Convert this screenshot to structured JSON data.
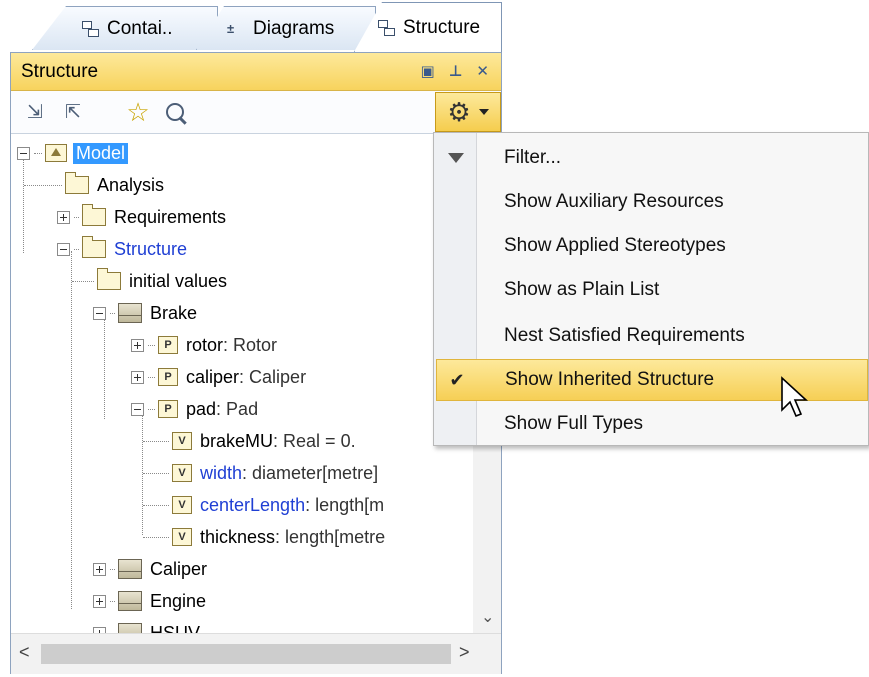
{
  "tabs": [
    {
      "label": "Contai..",
      "icon": "containment-icon"
    },
    {
      "label": "Diagrams",
      "icon": "diagrams-icon"
    },
    {
      "label": "Structure",
      "icon": "structure-icon",
      "active": true
    }
  ],
  "panel": {
    "title": "Structure",
    "window_buttons": [
      "▣",
      "⊥",
      "✕"
    ]
  },
  "toolbar": {
    "expand_glyph": "⇲",
    "collapse_glyph": "⇱",
    "star_glyph": "☆",
    "gear_glyph": "⚙"
  },
  "tree": {
    "nodes": [
      {
        "label": "Model",
        "icon": "model-icon",
        "style": "selected"
      },
      {
        "label": "Analysis",
        "icon": "folder-icon"
      },
      {
        "label": "Requirements",
        "icon": "folder-icon"
      },
      {
        "label": "Structure",
        "icon": "folder-icon",
        "style": "blue"
      },
      {
        "label": "initial values",
        "icon": "folder-icon"
      },
      {
        "label": "Brake",
        "icon": "block-icon"
      },
      {
        "label": "rotor",
        "type": " : Rotor",
        "icon": "part-icon",
        "tag": "P"
      },
      {
        "label": "caliper",
        "type": " : Caliper",
        "icon": "part-icon",
        "tag": "P"
      },
      {
        "label": "pad",
        "type": " : Pad",
        "icon": "part-icon",
        "tag": "P"
      },
      {
        "label": "brakeMU",
        "type": " : Real = 0.",
        "icon": "value-icon",
        "tag": "V"
      },
      {
        "label": "width",
        "type": " : diameter[metre]",
        "icon": "value-icon",
        "tag": "V",
        "style": "blue"
      },
      {
        "label": "centerLength",
        "type": " : length[m",
        "icon": "value-icon",
        "tag": "V",
        "style": "blue"
      },
      {
        "label": "thickness",
        "type": " : length[metre",
        "icon": "value-icon",
        "tag": "V"
      },
      {
        "label": "Caliper",
        "icon": "block-icon"
      },
      {
        "label": "Engine",
        "icon": "block-icon"
      },
      {
        "label": "HSUV",
        "icon": "block-icon"
      }
    ]
  },
  "scroll": {
    "down_glyph": "⌄",
    "left_glyph": "<",
    "right_glyph": ">"
  },
  "menu": {
    "items": [
      {
        "label": "Filter...",
        "icon": "filter-icon"
      },
      {
        "label": "Show Auxiliary Resources"
      },
      {
        "label": "Show Applied Stereotypes"
      },
      {
        "label": "Show as Plain List"
      },
      {
        "label": "Nest Satisfied Requirements"
      },
      {
        "label": "Show Inherited Structure",
        "checked": true,
        "check_glyph": "✔"
      },
      {
        "label": "Show Full Types"
      }
    ]
  },
  "colors": {
    "accent": "#f7d35d",
    "selection": "#3399ff",
    "link_blue": "#1f3fd4"
  }
}
